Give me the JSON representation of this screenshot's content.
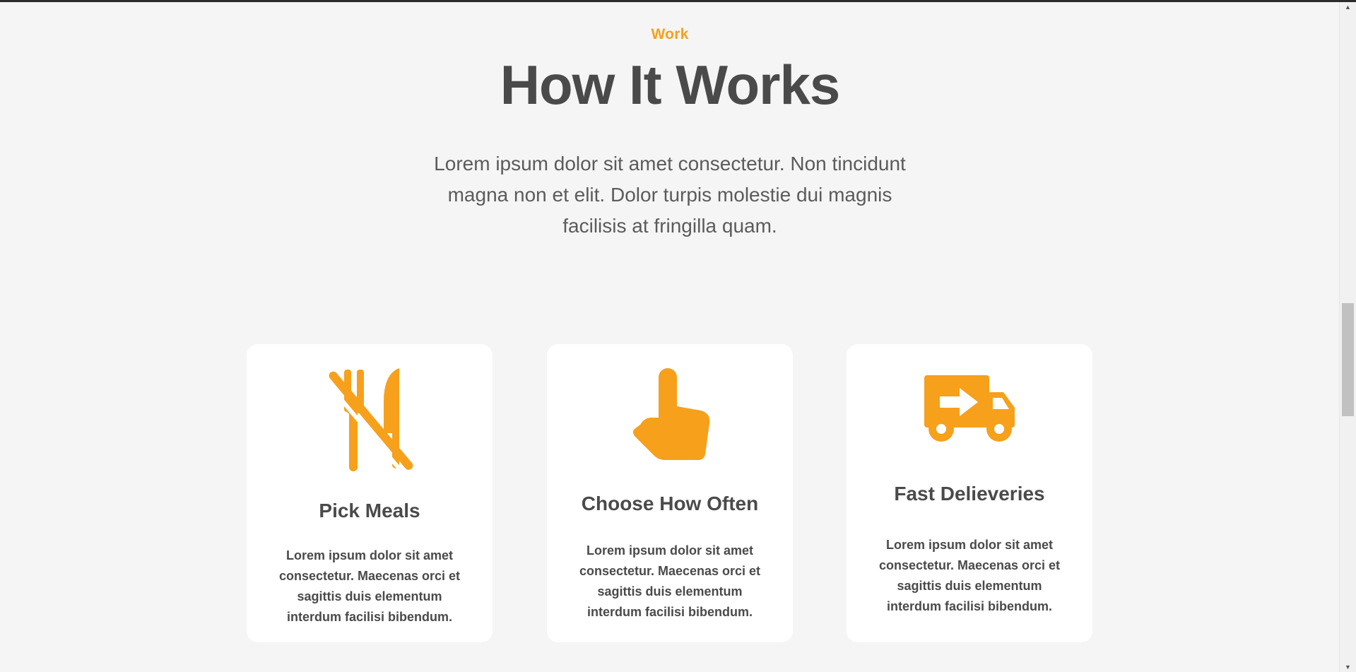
{
  "section": {
    "eyebrow": "Work",
    "title": "How It Works",
    "lead": "Lorem ipsum dolor sit amet consectetur. Non tincidunt magna non et elit. Dolor turpis molestie dui magnis facilisis at fringilla quam."
  },
  "cards": [
    {
      "icon": "no-meals-icon",
      "title": "Pick Meals",
      "body": "Lorem ipsum dolor sit amet consectetur. Maecenas orci et sagittis duis elementum interdum facilisi bibendum."
    },
    {
      "icon": "pointing-hand-icon",
      "title": "Choose How Often",
      "body": "Lorem ipsum dolor sit amet consectetur. Maecenas orci et sagittis duis elementum interdum facilisi bibendum."
    },
    {
      "icon": "delivery-truck-icon",
      "title": "Fast Delieveries",
      "body": "Lorem ipsum dolor sit amet consectetur. Maecenas orci et sagittis duis elementum interdum facilisi bibendum."
    }
  ],
  "colors": {
    "accent": "#f7a01b",
    "heading": "#4a4a4a",
    "background": "#f5f5f5",
    "card": "#ffffff"
  }
}
